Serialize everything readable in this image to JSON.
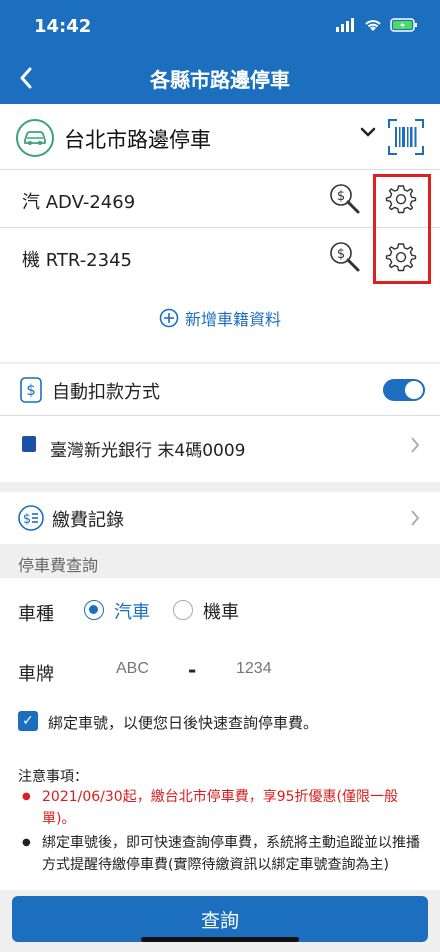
{
  "status_bar": {
    "time": "14:42"
  },
  "nav": {
    "title": "各縣市路邊停車"
  },
  "parking": {
    "city": "台北市路邊停車",
    "vehicles": [
      {
        "label": "汽 ADV-2469"
      },
      {
        "label": "機 RTR-2345"
      }
    ],
    "add_label": "新增車籍資料"
  },
  "payment": {
    "autopay_label": "自動扣款方式",
    "autopay_enabled": true,
    "bank_label": "臺灣新光銀行 末4碼0009"
  },
  "records": {
    "label": "繳費記錄"
  },
  "query": {
    "section_title": "停車費查詢",
    "type_label": "車種",
    "options": [
      "汽車",
      "機車"
    ],
    "selected_option": "汽車",
    "plate_label": "車牌",
    "plate_part1_placeholder": "ABC",
    "plate_dash": "-",
    "plate_part2_placeholder": "1234",
    "bind_checkbox_label": "綁定車號，以便您日後快速查詢停車費。",
    "bind_checked": true,
    "notice_title": "注意事項：",
    "notices": [
      "2021/06/30起，繳台北市停車費，享95折優惠(僅限一般單)。",
      "綁定車號後，即可快速查詢停車費，系統將主動追蹤並以推播方式提醒待繳停車費(實際待繳資訊以綁定車號查詢為主)"
    ],
    "submit_label": "查詢"
  },
  "colors": {
    "primary": "#1c6fbf",
    "highlight": "#e02020",
    "notice_red": "#d81e1e",
    "car_badge": "#3aa37a"
  },
  "icons": [
    "back-icon",
    "car-icon",
    "chevron-down-icon",
    "barcode-icon",
    "search-dollar-icon",
    "gear-icon",
    "plus-circle-icon",
    "dollar-refresh-icon",
    "bank-icon",
    "chevron-right-icon",
    "dollar-list-icon",
    "check-icon"
  ]
}
